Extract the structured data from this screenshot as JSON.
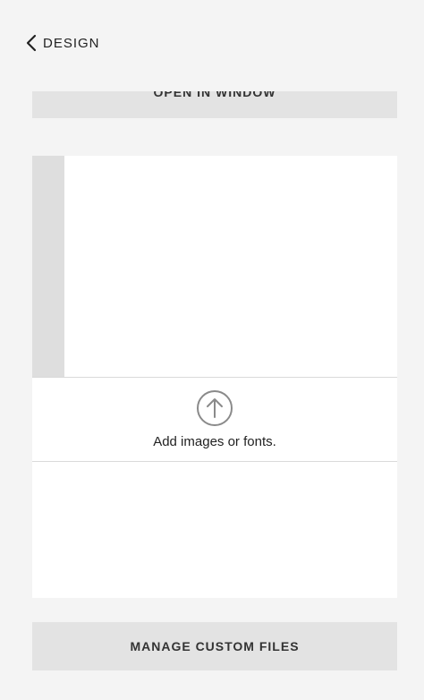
{
  "header": {
    "back_label": "DESIGN",
    "back_icon": "chevron-left-icon"
  },
  "open_window": {
    "label": "OPEN IN WINDOW"
  },
  "upload": {
    "label": "Add images or fonts.",
    "icon": "upload-arrow-icon"
  },
  "footer": {
    "manage_label": "MANAGE CUSTOM FILES"
  },
  "colors": {
    "panel_bg": "#f4f4f4",
    "button_bg": "#e3e3e3",
    "card_bg": "#ffffff",
    "icon_gray": "#8a8a8a"
  }
}
